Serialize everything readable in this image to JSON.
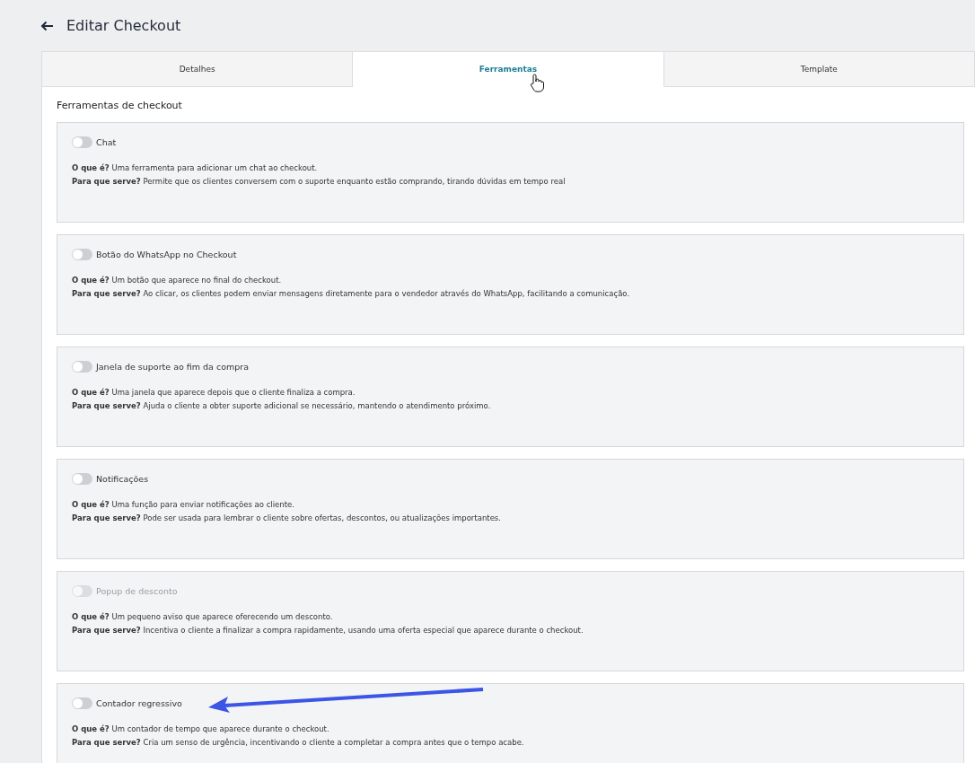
{
  "header": {
    "title": "Editar Checkout"
  },
  "tabs": [
    {
      "label": "Detalhes",
      "selected": false
    },
    {
      "label": "Ferramentas",
      "selected": true
    },
    {
      "label": "Template",
      "selected": false
    }
  ],
  "section_title": "Ferramentas de checkout",
  "tools": [
    {
      "label": "Chat",
      "on": false,
      "disabled": false,
      "what": "**O que é?** Uma ferramenta para adicionar um chat ao checkout.",
      "why": "**Para que serve?** Permite que os clientes conversem com o suporte enquanto estão comprando, tirando dúvidas em tempo real"
    },
    {
      "label": "Botão do WhatsApp no Checkout",
      "on": false,
      "disabled": false,
      "what": "**O que é?** Um botão que aparece no final do checkout.",
      "why": "**Para que serve?** Ao clicar, os clientes podem enviar mensagens diretamente para o vendedor através do WhatsApp, facilitando a comunicação."
    },
    {
      "label": "Janela de suporte ao fim da compra",
      "on": false,
      "disabled": false,
      "what": "**O que é?** Uma janela que aparece depois que o cliente finaliza a compra.",
      "why": "**Para que serve?** Ajuda o cliente a obter suporte adicional se necessário, mantendo o atendimento próximo."
    },
    {
      "label": "Notificações",
      "on": false,
      "disabled": false,
      "what": "**O que é?** Uma função para enviar notificações ao cliente.",
      "why": "**Para que serve?** Pode ser usada para lembrar o cliente sobre ofertas, descontos, ou atualizações importantes."
    },
    {
      "label": "Popup de desconto",
      "on": false,
      "disabled": true,
      "what": "**O que é?** Um pequeno aviso que aparece oferecendo um desconto.",
      "why": "**Para que serve?** Incentiva o cliente a finalizar a compra rapidamente, usando uma oferta especial que aparece durante o checkout."
    },
    {
      "label": "Contador regressivo",
      "on": false,
      "disabled": false,
      "what": "**O que é?** Um contador de tempo que aparece durante o checkout.",
      "why": "**Para que serve?** Cria um senso de urgência, incentivando o cliente a completar a compra antes que o tempo acabe."
    }
  ]
}
